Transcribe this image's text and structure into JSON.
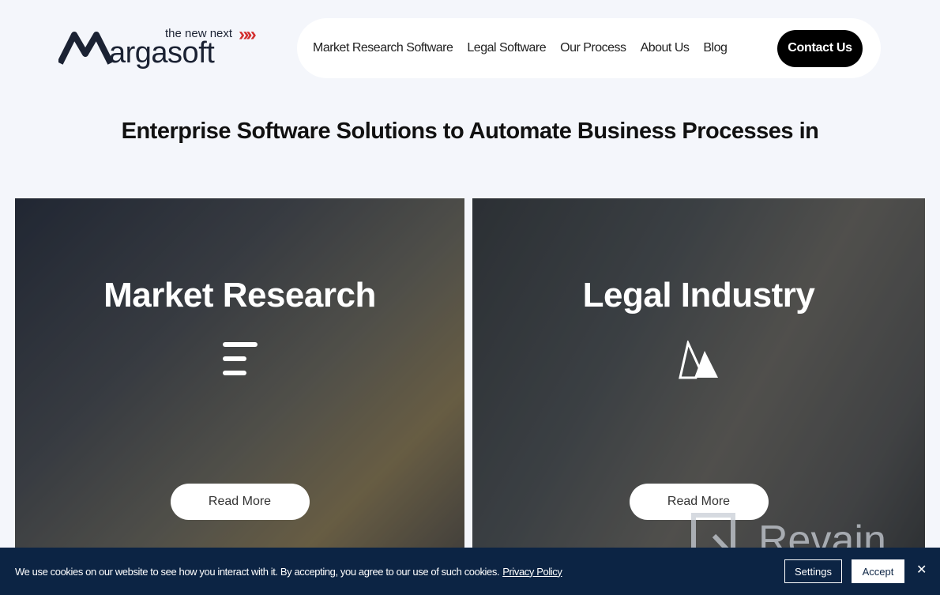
{
  "brand": {
    "logo_text": "Margasoft",
    "tagline": "the new next",
    "accent": "#d32f2f"
  },
  "nav": {
    "items": [
      "Market Research Software",
      "Legal Software",
      "Our Process",
      "About Us",
      "Blog"
    ],
    "contact": "Contact Us"
  },
  "hero": {
    "title": "Enterprise Software Solutions to Automate Business Processes in"
  },
  "cards": [
    {
      "title": "Market Research",
      "icon": "bars-icon",
      "button": "Read More"
    },
    {
      "title": "Legal Industry",
      "icon": "mountain-icon",
      "button": "Read More"
    }
  ],
  "cookie": {
    "text": "We use cookies on our website to see how you interact with it. By accepting, you agree to our use of such cookies.",
    "privacy": "Privacy Policy",
    "settings": "Settings",
    "accept": "Accept",
    "close": "✕",
    "bg": "#0c2444"
  },
  "watermark": {
    "text": "Revain"
  }
}
